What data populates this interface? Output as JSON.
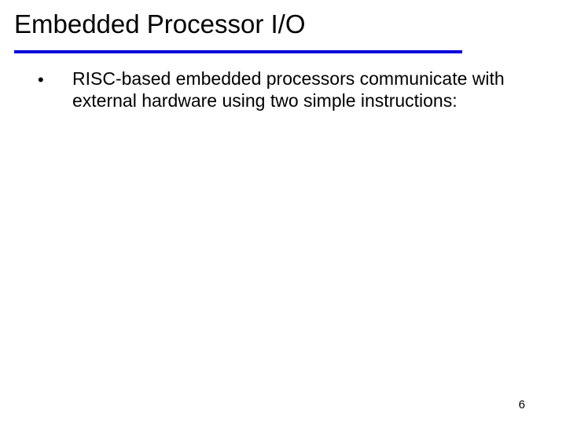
{
  "slide": {
    "title": "Embedded Processor I/O",
    "bullets": [
      {
        "mark": "•",
        "text": "RISC-based embedded processors communicate with external hardware using two simple instructions:"
      }
    ],
    "page_number": "6"
  },
  "colors": {
    "rule": "#0000dd"
  }
}
